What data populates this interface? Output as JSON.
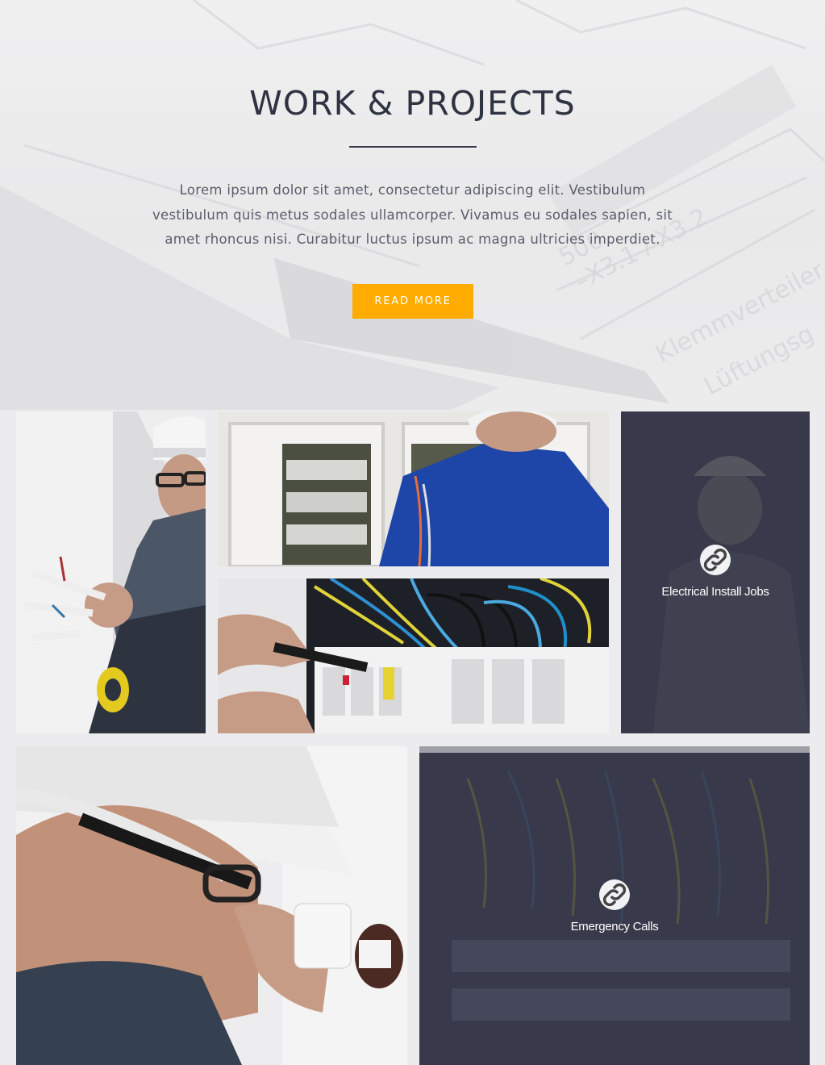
{
  "hero": {
    "title": "WORK & PROJECTS",
    "description": "Lorem ipsum dolor sit amet, consectetur adipiscing elit. Vestibulum vestibulum quis metus sodales ullamcorper. Vivamus eu sodales sapien, sit amet rhoncus nisi. Curabitur luctus ipsum ac magna ultricies imperdiet.",
    "button_label": "READ MORE"
  },
  "gallery": {
    "items": [
      {
        "image": "electrician-with-tape-photo"
      },
      {
        "image": "electrician-blue-jacket-panel-photo"
      },
      {
        "image": "breaker-panel-screwdriver-photo"
      },
      {
        "label": "Electrical Install Jobs",
        "icon": "link-icon"
      },
      {
        "image": "electrician-hardhat-socket-photo"
      },
      {
        "label": "Emergency Calls",
        "icon": "link-icon"
      }
    ]
  },
  "colors": {
    "accent": "#ffab00",
    "overlay": "#383a4b",
    "title": "#2f3241"
  }
}
